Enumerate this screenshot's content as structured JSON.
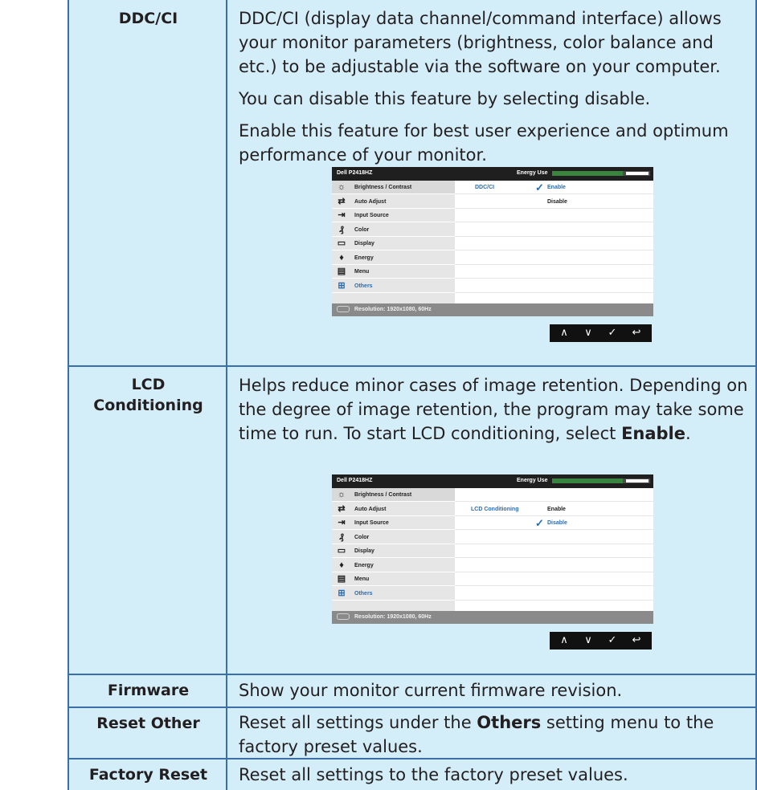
{
  "rows": [
    {
      "name": "DDC/CI",
      "paragraphs": [
        "DDC/CI (display data channel/command interface) allows your monitor parameters (brightness, color balance and etc.) to be adjustable via the software on your computer.",
        "You can disable this feature by selecting disable.",
        "Enable this feature for best user experience and optimum performance of your monitor."
      ]
    },
    {
      "name_line1": "LCD",
      "name_line2": "Conditioning",
      "text_pre": "Helps reduce minor cases of image retention. Depending on the degree of image retention, the program may take some time to run. To start LCD conditioning, select ",
      "text_bold": "Enable",
      "text_post": "."
    },
    {
      "name": "Firmware",
      "text": "Show your monitor current firmware revision."
    },
    {
      "name": "Reset Other",
      "text_pre": "Reset all settings under the ",
      "text_bold": "Others",
      "text_post": " setting menu to the factory preset values."
    },
    {
      "name": "Factory Reset",
      "text": "Reset all settings to the factory preset values."
    }
  ],
  "osd": {
    "model": "Dell P2418HZ",
    "energy_label": "Energy Use",
    "energy_level": 0.72,
    "menu_items": [
      {
        "label": "Brightness / Contrast",
        "icon": "brightness-icon",
        "glyph": "☼"
      },
      {
        "label": "Auto Adjust",
        "icon": "auto-adjust-icon",
        "glyph": "⇄"
      },
      {
        "label": "Input Source",
        "icon": "input-source-icon",
        "glyph": "⇥"
      },
      {
        "label": "Color",
        "icon": "color-icon",
        "glyph": "₰"
      },
      {
        "label": "Display",
        "icon": "display-icon",
        "glyph": "▭"
      },
      {
        "label": "Energy",
        "icon": "energy-icon",
        "glyph": "♦"
      },
      {
        "label": "Menu",
        "icon": "menu-icon",
        "glyph": "▤"
      },
      {
        "label": "Others",
        "icon": "others-icon",
        "glyph": "⊞"
      }
    ],
    "status": "Resolution: 1920x1080, 60Hz",
    "osd1": {
      "setting": "DDC/CI",
      "options": [
        "Enable",
        "Disable"
      ],
      "selected": "Enable"
    },
    "osd2": {
      "setting": "LCD Conditioning",
      "options": [
        "Enable",
        "Disable"
      ],
      "selected": "Disable"
    },
    "nav_buttons": [
      {
        "name": "up-button",
        "glyph": "∧"
      },
      {
        "name": "down-button",
        "glyph": "∨"
      },
      {
        "name": "confirm-button",
        "glyph": "✓"
      },
      {
        "name": "back-button",
        "glyph": "↩"
      }
    ]
  },
  "colors": {
    "border": "#3a6fa8",
    "cell_bg": "#d4eef9",
    "osd_accent": "#2b6cb0",
    "energy_green": "#39853f"
  }
}
